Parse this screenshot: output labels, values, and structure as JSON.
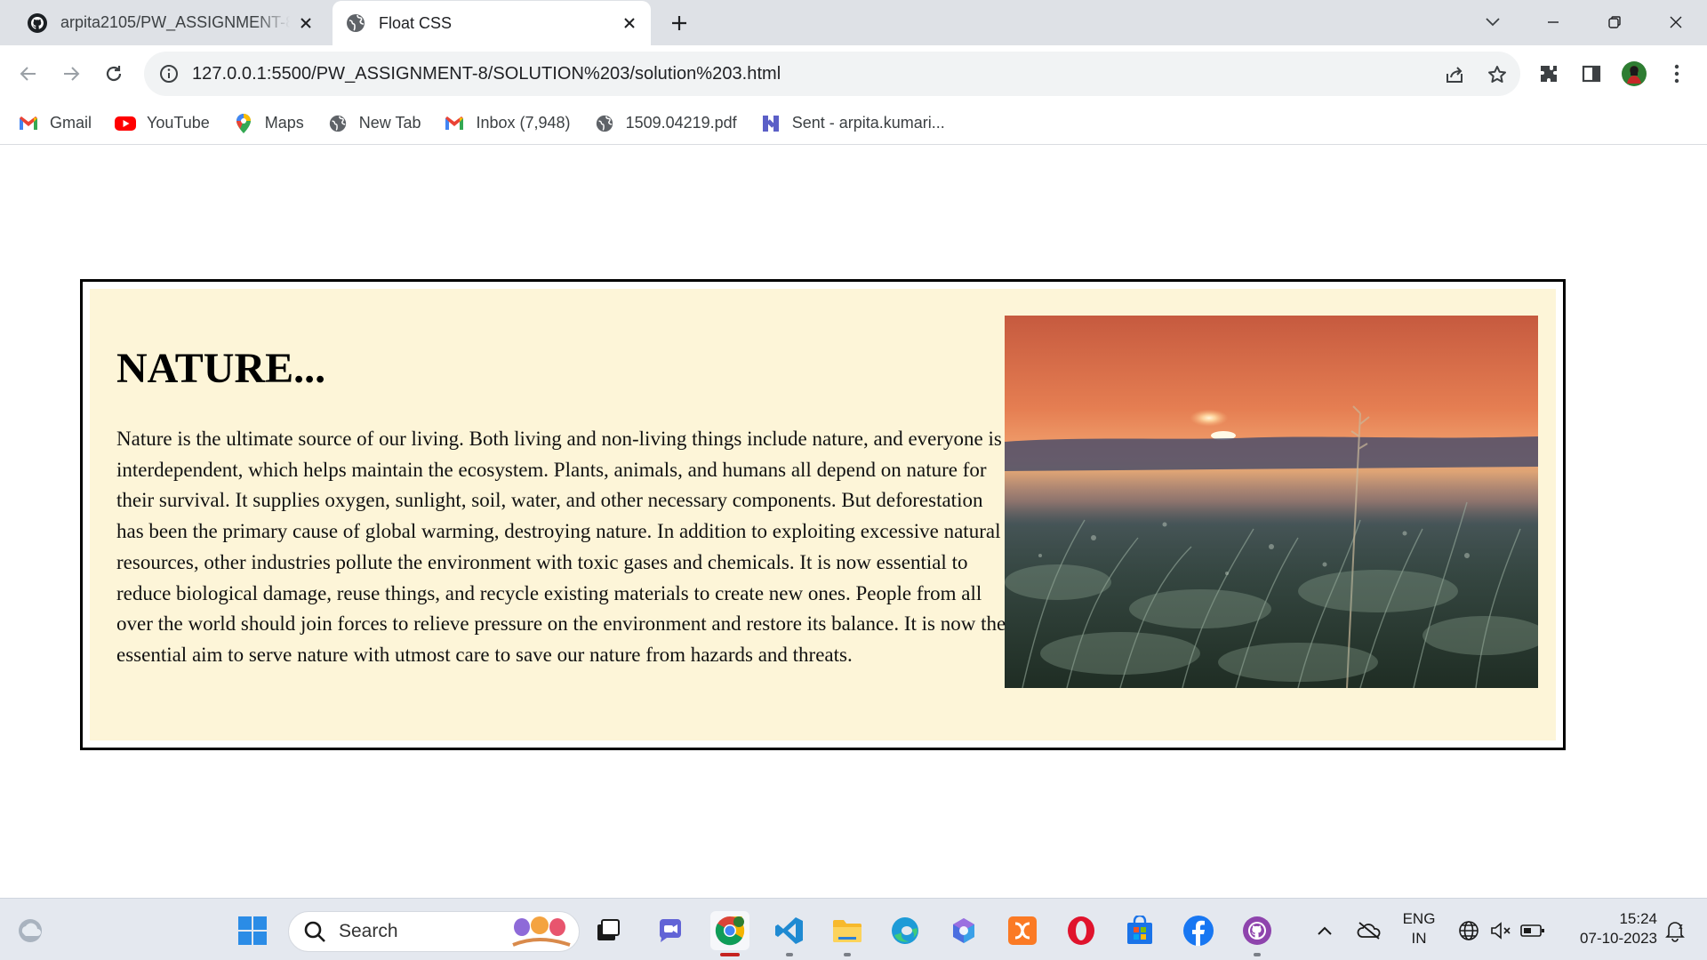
{
  "browser": {
    "tabs": [
      {
        "title": "arpita2105/PW_ASSIGNMENT-8",
        "icon": "github-icon",
        "active": false
      },
      {
        "title": "Float CSS",
        "icon": "globe-icon",
        "active": true
      }
    ],
    "url": "127.0.0.1:5500/PW_ASSIGNMENT-8/SOLUTION%203/solution%203.html",
    "bookmarks": [
      {
        "label": "Gmail",
        "icon": "gmail-icon"
      },
      {
        "label": "YouTube",
        "icon": "youtube-icon"
      },
      {
        "label": "Maps",
        "icon": "maps-icon"
      },
      {
        "label": "New Tab",
        "icon": "globe-icon"
      },
      {
        "label": "Inbox (7,948)",
        "icon": "gmail-icon"
      },
      {
        "label": "1509.04219.pdf",
        "icon": "globe-icon"
      },
      {
        "label": "Sent - arpita.kumari...",
        "icon": "teams-icon"
      }
    ]
  },
  "page": {
    "heading": "NATURE...",
    "paragraph": "Nature is the ultimate source of our living. Both living and non-living things include nature, and everyone is interdependent, which helps maintain the ecosystem. Plants, animals, and humans all depend on nature for their survival. It supplies oxygen, sunlight, soil, water, and other necessary components. But deforestation has been the primary cause of global warming, destroying nature. In addition to exploiting excessive natural resources, other industries pollute the environment with toxic gases and chemicals. It is now essential to reduce biological damage, reuse things, and recycle existing materials to create new ones. People from all over the world should join forces to relieve pressure on the environment and restore its balance. It is now the essential aim to serve nature with utmost care to save our nature from hazards and threats.",
    "image": {
      "description_icon": "sunset-field-image"
    },
    "colors": {
      "box_background": "#fdf5d8",
      "border": "#000000"
    }
  },
  "taskbar": {
    "search_label": "Search",
    "language": {
      "line1": "ENG",
      "line2": "IN"
    },
    "time": "15:24",
    "date": "07-10-2023"
  }
}
